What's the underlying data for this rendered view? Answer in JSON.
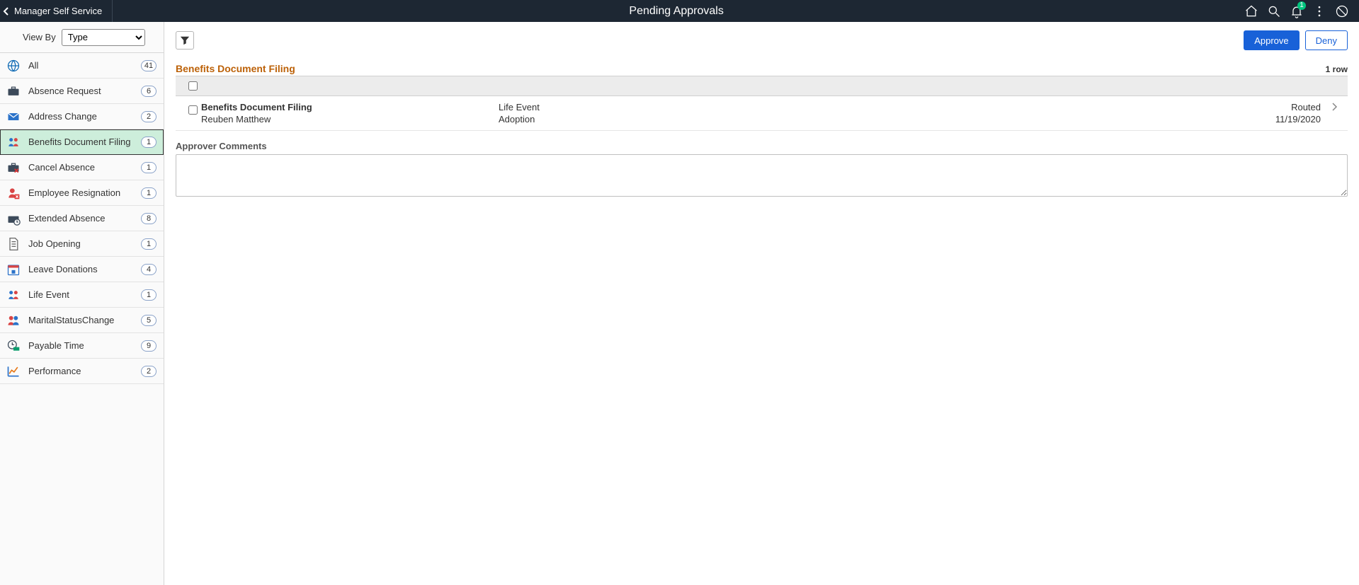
{
  "banner": {
    "back_label": "Manager Self Service",
    "title": "Pending Approvals",
    "notification_count": "1"
  },
  "sidebar": {
    "view_by_label": "View By",
    "view_by_options": [
      "Type"
    ],
    "view_by_selected": "Type",
    "items": [
      {
        "label": "All",
        "count": "41",
        "selected": false
      },
      {
        "label": "Absence Request",
        "count": "6",
        "selected": false
      },
      {
        "label": "Address Change",
        "count": "2",
        "selected": false
      },
      {
        "label": "Benefits Document Filing",
        "count": "1",
        "selected": true
      },
      {
        "label": "Cancel Absence",
        "count": "1",
        "selected": false
      },
      {
        "label": "Employee Resignation",
        "count": "1",
        "selected": false
      },
      {
        "label": "Extended Absence",
        "count": "8",
        "selected": false
      },
      {
        "label": "Job Opening",
        "count": "1",
        "selected": false
      },
      {
        "label": "Leave Donations",
        "count": "4",
        "selected": false
      },
      {
        "label": "Life Event",
        "count": "1",
        "selected": false
      },
      {
        "label": "MaritalStatusChange",
        "count": "5",
        "selected": false
      },
      {
        "label": "Payable Time",
        "count": "9",
        "selected": false
      },
      {
        "label": "Performance",
        "count": "2",
        "selected": false
      }
    ]
  },
  "actions": {
    "approve_label": "Approve",
    "deny_label": "Deny"
  },
  "section": {
    "title": "Benefits Document Filing",
    "row_count": "1 row"
  },
  "rows": [
    {
      "title": "Benefits Document Filing",
      "requester": "Reuben Matthew",
      "category": "Life Event",
      "detail": "Adoption",
      "status": "Routed",
      "date": "11/19/2020"
    }
  ],
  "comments": {
    "label": "Approver Comments",
    "value": ""
  }
}
